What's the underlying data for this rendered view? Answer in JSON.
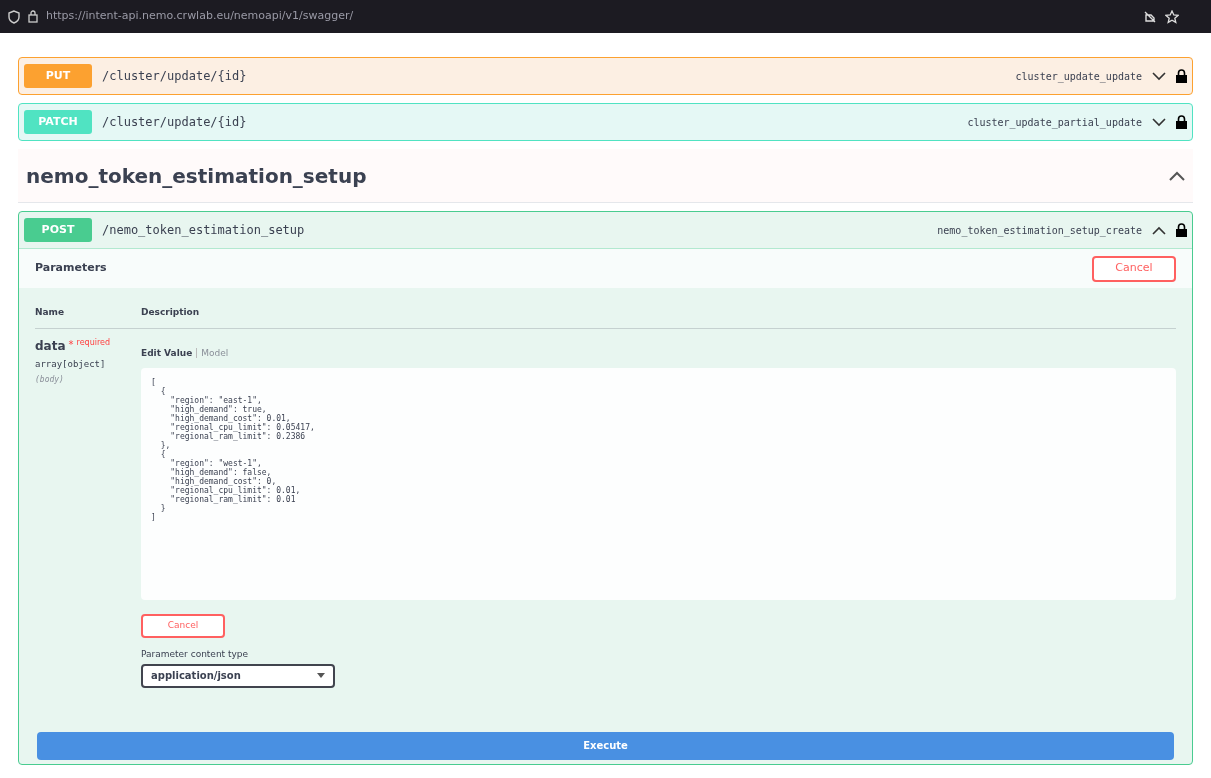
{
  "browser": {
    "url": "https://intent-api.nemo.crwlab.eu/nemoapi/v1/swagger/"
  },
  "operations_above": [
    {
      "method": "PUT",
      "path": "/cluster/update/{id}",
      "operation_id": "cluster_update_update",
      "expanded": false
    },
    {
      "method": "PATCH",
      "path": "/cluster/update/{id}",
      "operation_id": "cluster_update_partial_update",
      "expanded": false
    }
  ],
  "section": {
    "title": "nemo_token_estimation_setup",
    "expanded": true
  },
  "operation": {
    "method": "POST",
    "path": "/nemo_token_estimation_setup",
    "operation_id": "nemo_token_estimation_setup_create",
    "expanded": true,
    "parameters_title": "Parameters",
    "cancel_label": "Cancel",
    "columns": [
      "Name",
      "Description"
    ],
    "parameter": {
      "name": "data",
      "required_mark": "*",
      "required_label": "required",
      "type": "array[object]",
      "location": "(body)",
      "tabs": [
        {
          "label": "Edit Value",
          "selected": true
        },
        {
          "label": "Model",
          "selected": false
        }
      ],
      "value": "[\n  {\n    \"region\": \"east-1\",\n    \"high_demand\": true,\n    \"high_demand_cost\": 0.01,\n    \"regional_cpu_limit\": 0.05417,\n    \"regional_ram_limit\": 0.2386\n  },\n  {\n    \"region\": \"west-1\",\n    \"high_demand\": false,\n    \"high_demand_cost\": 0,\n    \"regional_cpu_limit\": 0.01,\n    \"regional_ram_limit\": 0.01\n  }\n]",
      "cancel_label": "Cancel",
      "content_type_label": "Parameter content type",
      "content_type": "application/json"
    },
    "execute_label": "Execute"
  }
}
